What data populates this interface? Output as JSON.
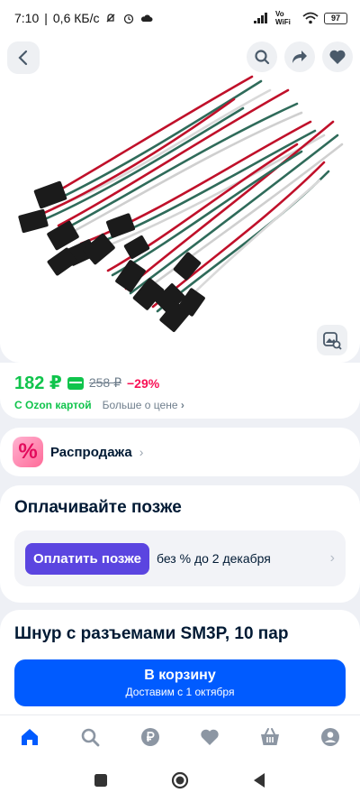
{
  "status_bar": {
    "time": "7:10",
    "speed": "0,6 КБ/с",
    "network": "Vo WiFi",
    "battery": "97"
  },
  "price": {
    "current": "182 ₽",
    "old": "258 ₽",
    "discount": "−29%",
    "ozon_card_label": "С Ozon картой",
    "more_price_label": "Больше о цене",
    "accent_color": "#10c44c"
  },
  "sale": {
    "label": "Распродажа",
    "icon_glyph": "%"
  },
  "pay_later": {
    "title": "Оплачивайте позже",
    "button_label": "Оплатить позже",
    "note": "без % до 2 декабря"
  },
  "product": {
    "title": "Шнур с разъемами SM3P, 10 пар",
    "cart_label": "В корзину",
    "delivery": "Доставим с 1 октября"
  },
  "tabs": [
    {
      "name": "home",
      "icon": "home-icon",
      "active": true
    },
    {
      "name": "search",
      "icon": "search-icon",
      "active": false
    },
    {
      "name": "points",
      "icon": "ruble-points-icon",
      "active": false
    },
    {
      "name": "favorites",
      "icon": "heart-icon",
      "active": false
    },
    {
      "name": "cart",
      "icon": "basket-icon",
      "active": false
    },
    {
      "name": "profile",
      "icon": "profile-icon",
      "active": false
    }
  ],
  "colors": {
    "brand_blue": "#005bff",
    "pay_later_purple": "#5b45e0",
    "discount_red": "#f91155",
    "green": "#10c44c"
  }
}
